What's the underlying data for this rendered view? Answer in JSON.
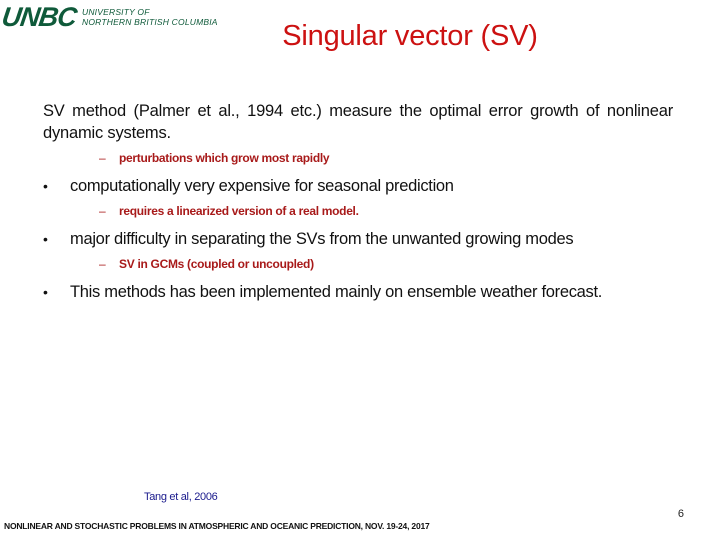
{
  "logo": {
    "mark": "UNBC",
    "line1": "UNIVERSITY OF",
    "line2": "NORTHERN BRITISH COLUMBIA",
    "color": "#0f5a3a"
  },
  "slide": {
    "title": "Singular vector (SV)",
    "intro": "SV method (Palmer et al., 1994 etc.) measure the optimal error growth of nonlinear dynamic systems.",
    "intro_sub": "perturbations which grow most rapidly",
    "bullets": [
      {
        "text": "computationally very expensive for seasonal prediction",
        "sub": "requires a linearized version of a real model."
      },
      {
        "text": "major difficulty in separating the SVs from the unwanted growing modes",
        "sub": "SV in GCMs (coupled or uncoupled)"
      },
      {
        "text": "This methods has been implemented mainly on ensemble weather forecast."
      }
    ],
    "bullet_glyph": "•",
    "dash_glyph": "–",
    "citation": "Tang et al, 2006",
    "page_number": "6",
    "footer": "NONLINEAR AND STOCHASTIC PROBLEMS IN ATMOSPHERIC AND OCEANIC PREDICTION, NOV. 19-24, 2017"
  },
  "colors": {
    "title": "#cc1111",
    "sub": "#a81a1a",
    "citation": "#1a1a8c"
  }
}
